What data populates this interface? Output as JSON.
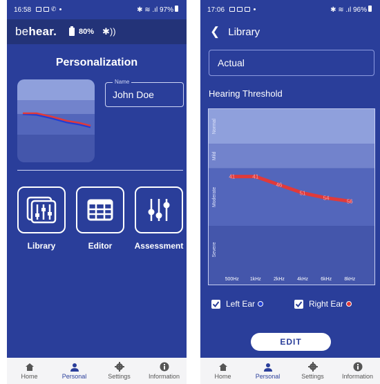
{
  "left": {
    "status": {
      "time": "16:58",
      "battery": "97%"
    },
    "header": {
      "brand_be": "be",
      "brand_hear": "hear.",
      "battery_pct": "80%"
    },
    "title": "Personalization",
    "name_field": {
      "label": "Name",
      "value": "John Doe"
    },
    "tiles": [
      {
        "label": "Library",
        "icon": "library-sliders-icon"
      },
      {
        "label": "Editor",
        "icon": "grid-table-icon"
      },
      {
        "label": "Assessment",
        "icon": "sliders-icon"
      }
    ]
  },
  "right": {
    "status": {
      "time": "17:06",
      "battery": "96%"
    },
    "header": {
      "title": "Library"
    },
    "preset_value": "Actual",
    "chart_title": "Hearing Threshold",
    "left_ear_label": "Left Ear",
    "right_ear_label": "Right Ear",
    "edit_label": "EDIT"
  },
  "nav": [
    {
      "label": "Home",
      "icon": "home-icon"
    },
    {
      "label": "Personal",
      "icon": "person-icon",
      "active": true
    },
    {
      "label": "Settings",
      "icon": "gear-icon"
    },
    {
      "label": "Information",
      "icon": "info-icon"
    }
  ],
  "colors": {
    "background": "#2a3e9a",
    "header_dark": "#233378",
    "band_normal": "#8fa0dc",
    "band_mild": "#7283cc",
    "band_moderate": "#5366bb",
    "band_severe": "#4456ab",
    "right_ear": "#e03a3a",
    "left_ear": "#1f3fd6",
    "nav_background": "#f4f4f6"
  },
  "chart_data": {
    "type": "line",
    "title": "Hearing Threshold",
    "categories": [
      "500Hz",
      "1kHz",
      "2kHz",
      "4kHz",
      "6kHz",
      "8kHz"
    ],
    "bands": [
      "Normal",
      "Mild",
      "Moderate",
      "Severe"
    ],
    "series": [
      {
        "name": "Right Ear",
        "values": [
          41,
          41,
          46,
          51,
          54,
          56
        ]
      }
    ],
    "ylim": [
      0,
      100
    ],
    "inverted_y": true,
    "data_labels": [
      "41",
      "41",
      "46",
      "51",
      "54",
      "56"
    ]
  }
}
